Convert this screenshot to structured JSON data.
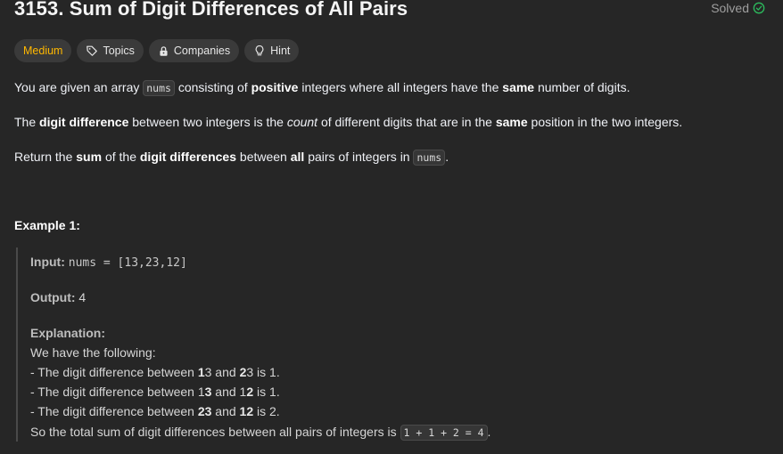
{
  "problem": {
    "title": "3153. Sum of Digit Differences of All Pairs",
    "status": "Solved"
  },
  "tags": {
    "difficulty": "Medium",
    "topics": "Topics",
    "companies": "Companies",
    "hint": "Hint"
  },
  "description": {
    "p1": {
      "a": "You are given an array ",
      "code": "nums",
      "b": " consisting of ",
      "bold1": "positive",
      "c": " integers where all integers have the ",
      "bold2": "same",
      "d": " number of digits."
    },
    "p2": {
      "a": "The ",
      "bold1": "digit difference",
      "b": " between two integers is the ",
      "italic": "count",
      "c": " of different digits that are in the ",
      "bold2": "same",
      "d": " position in the two integers."
    },
    "p3": {
      "a": "Return the ",
      "bold1": "sum",
      "b": " of the ",
      "bold2": "digit differences",
      "c": " between ",
      "bold3": "all",
      "d": " pairs of integers in ",
      "code": "nums",
      "e": "."
    }
  },
  "example": {
    "title": "Example 1:",
    "input_label": "Input:",
    "input_value": "nums = [13,23,12]",
    "output_label": "Output:",
    "output_value": "4",
    "explanation_label": "Explanation:",
    "line1": "We have the following:",
    "line2": {
      "a": "- The digit difference between ",
      "b1": "1",
      "c": "3 and ",
      "b2": "2",
      "d": "3 is 1."
    },
    "line3": {
      "a": "- The digit difference between 1",
      "b1": "3",
      "c": " and 1",
      "b2": "2",
      "d": " is 1."
    },
    "line4": {
      "a": "- The digit difference between ",
      "b1": "23",
      "c": " and ",
      "b2": "12",
      "d": " is 2."
    },
    "line5": {
      "a": "So the total sum of digit differences between all pairs of integers is ",
      "code": "1 + 1 + 2 = 4",
      "e": "."
    }
  },
  "colors": {
    "background": "#262626",
    "medium": "#ffb800",
    "solved_check": "#2cbb5d"
  },
  "icons": {
    "solved": "check-circle-icon",
    "topics": "tag-icon",
    "companies": "lock-icon",
    "hint": "lightbulb-icon"
  }
}
